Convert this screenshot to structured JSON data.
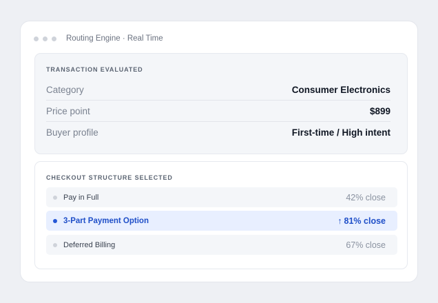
{
  "window": {
    "title": "Routing Engine · Real Time"
  },
  "transaction": {
    "heading": "TRANSACTION EVALUATED",
    "rows": [
      {
        "key": "Category",
        "value": "Consumer Electronics"
      },
      {
        "key": "Price point",
        "value": "$899"
      },
      {
        "key": "Buyer profile",
        "value": "First-time / High intent"
      }
    ]
  },
  "checkout": {
    "heading": "CHECKOUT STRUCTURE SELECTED",
    "options": [
      {
        "name": "Pay in Full",
        "rate": "42% close",
        "selected": false
      },
      {
        "name": "3-Part Payment Option",
        "rate": "81% close",
        "arrow": "↑",
        "selected": true
      },
      {
        "name": "Deferred Billing",
        "rate": "67% close",
        "selected": false
      }
    ]
  },
  "colors": {
    "accent": "#1f4fc8",
    "selected_bg": "#e8efff",
    "panel_bg": "#f4f6f9"
  },
  "icons": {
    "window_controls": "dot-icon",
    "selected_arrow": "arrow-up-icon"
  }
}
